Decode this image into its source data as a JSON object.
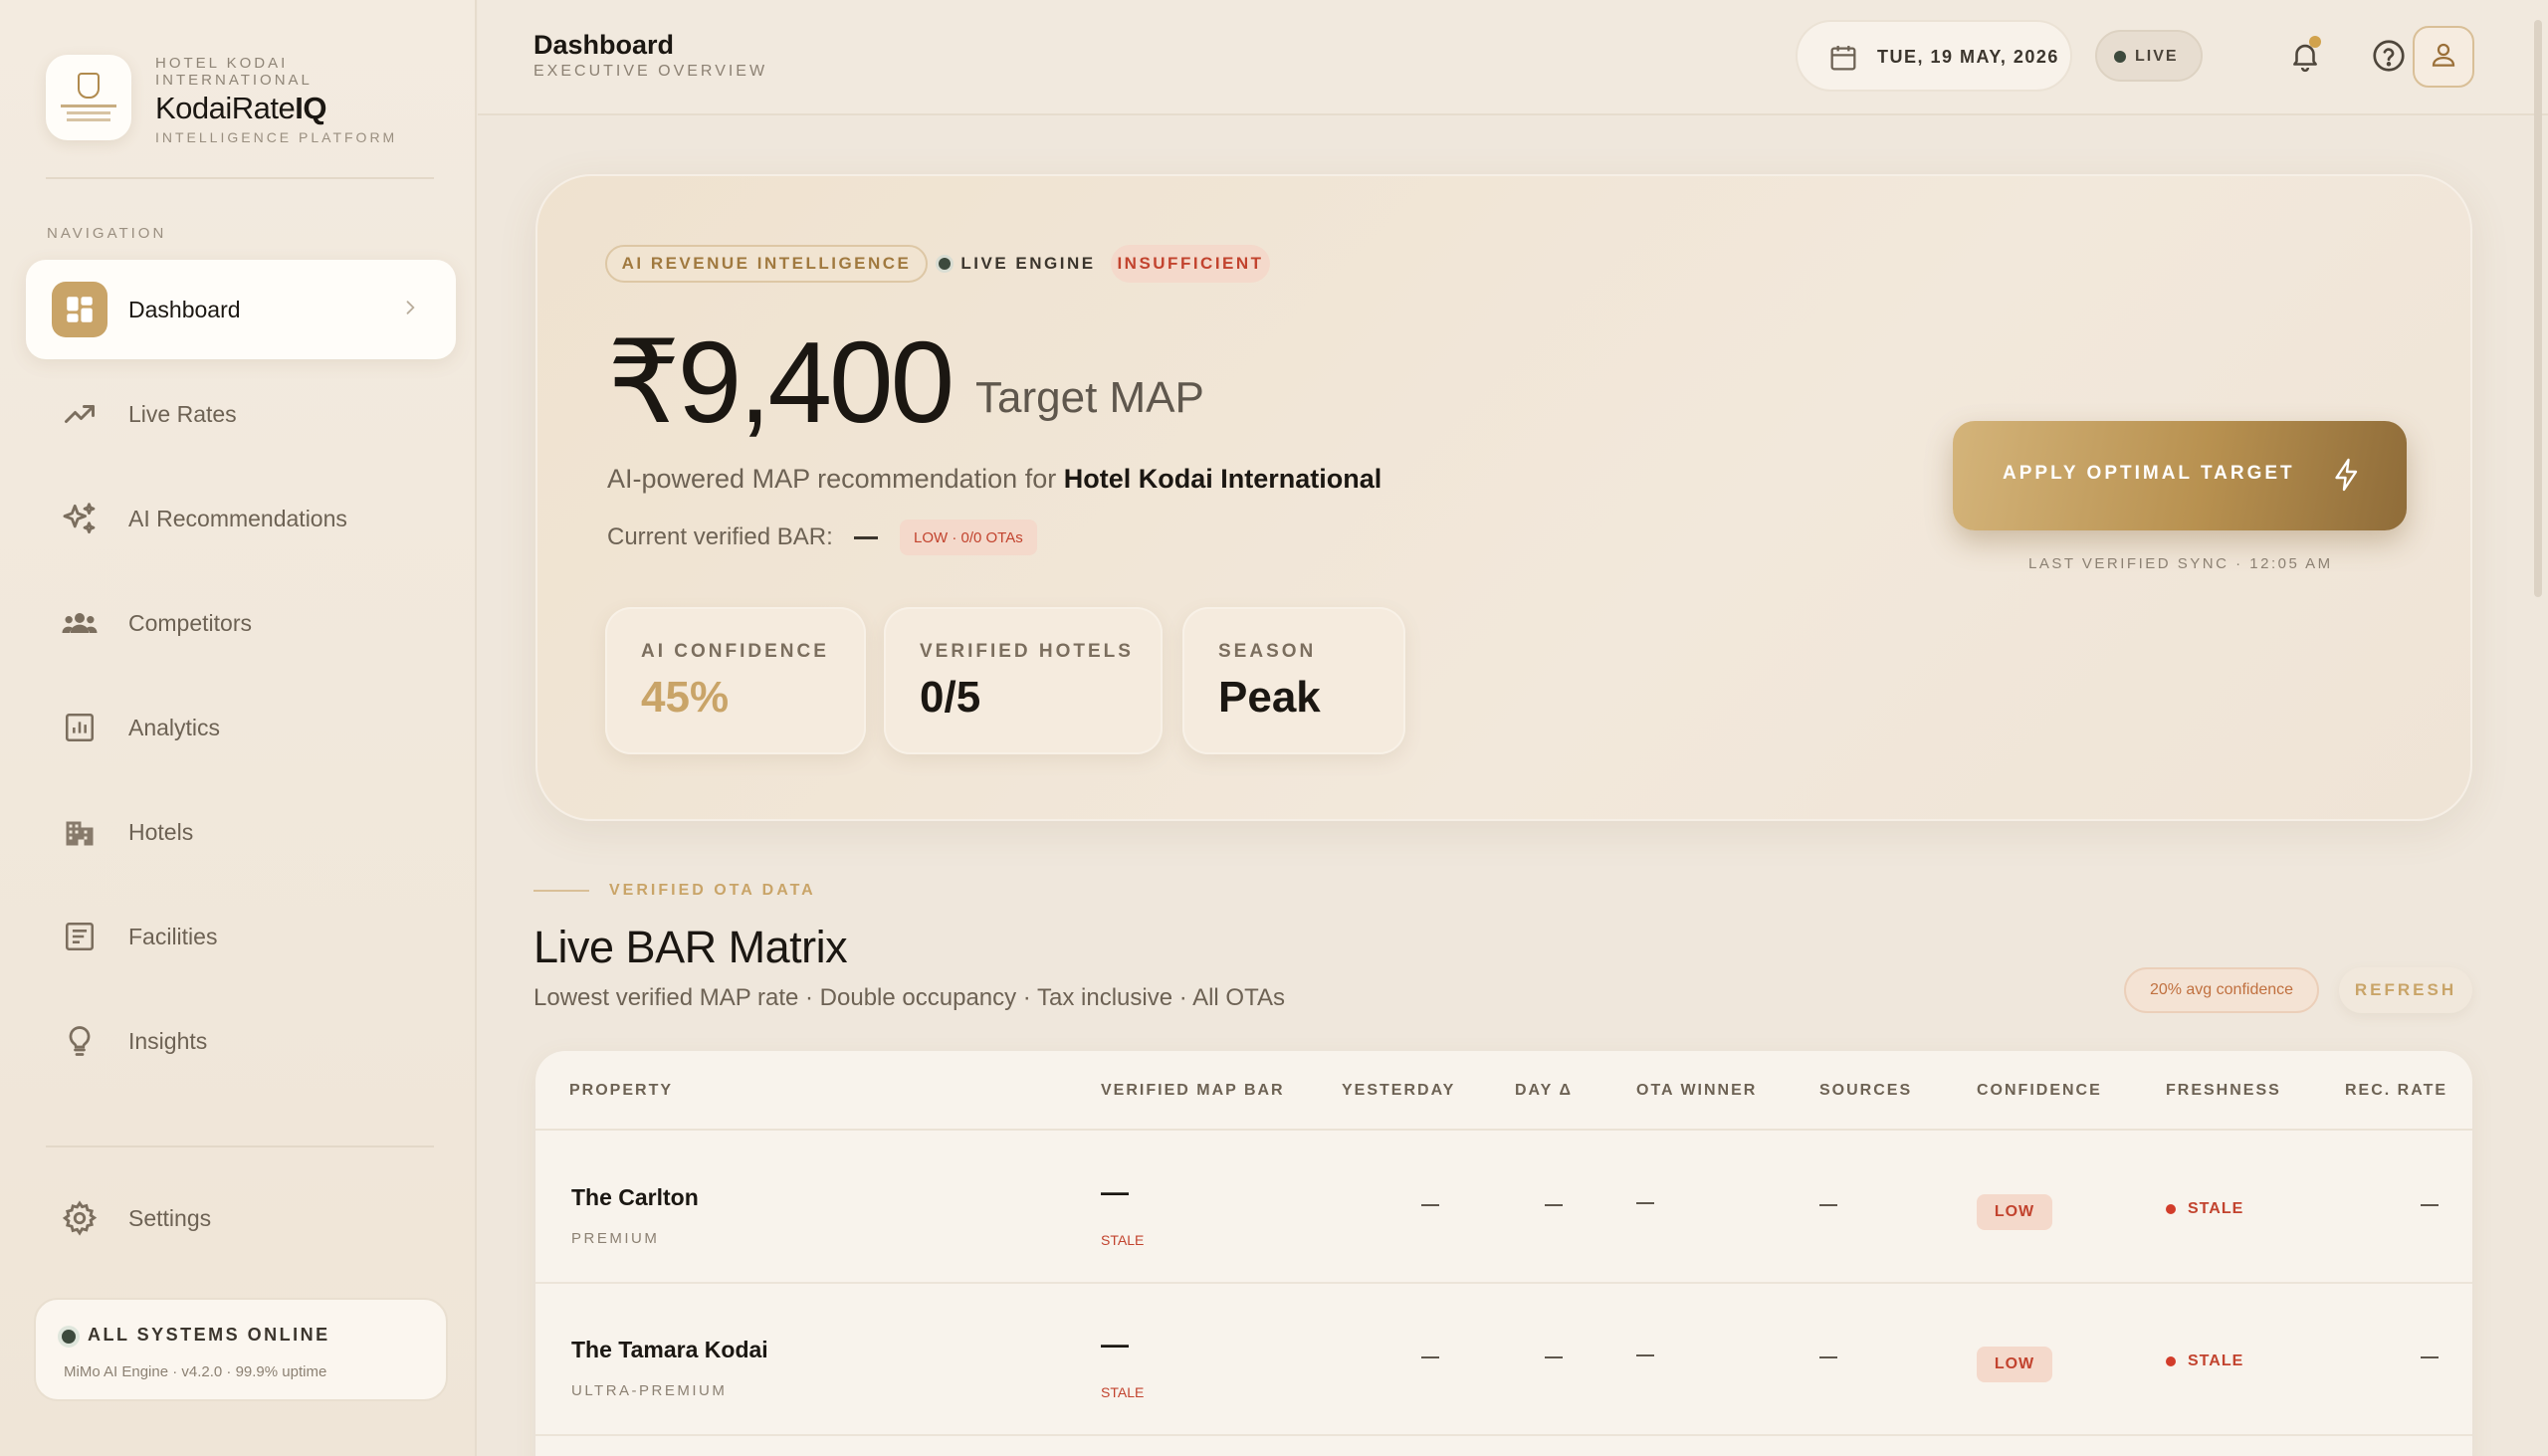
{
  "brand": {
    "overline": "HOTEL KODAI INTERNATIONAL",
    "name_regular": "KodaiRate",
    "name_bold": "IQ",
    "subtitle": "INTELLIGENCE PLATFORM"
  },
  "sidebar": {
    "nav_heading": "NAVIGATION",
    "items": [
      {
        "label": "Dashboard",
        "icon": "dashboard-grid-icon",
        "active": true
      },
      {
        "label": "Live Rates",
        "icon": "trending-up-icon"
      },
      {
        "label": "AI Recommendations",
        "icon": "sparkles-icon"
      },
      {
        "label": "Competitors",
        "icon": "users-icon"
      },
      {
        "label": "Analytics",
        "icon": "bar-chart-icon"
      },
      {
        "label": "Hotels",
        "icon": "building-icon"
      },
      {
        "label": "Facilities",
        "icon": "clipboard-icon"
      },
      {
        "label": "Insights",
        "icon": "lightbulb-icon"
      }
    ],
    "settings_label": "Settings",
    "status": {
      "title": "ALL SYSTEMS ONLINE",
      "detail": "MiMo AI Engine · v4.2.0 · 99.9% uptime"
    }
  },
  "topbar": {
    "title": "Dashboard",
    "subtitle": "EXECUTIVE OVERVIEW",
    "date": "TUE, 19 MAY, 2026",
    "live_label": "LIVE"
  },
  "hero": {
    "chip_ai": "AI REVENUE INTELLIGENCE",
    "chip_live": "LIVE ENGINE",
    "chip_status": "INSUFFICIENT",
    "price": "₹9,400",
    "price_label": "Target MAP",
    "rec_prefix": "AI-powered MAP recommendation for",
    "rec_hotel": "Hotel Kodai International",
    "bar_label": "Current verified BAR:",
    "bar_badge": "LOW · 0/0 OTAs",
    "metrics": [
      {
        "label": "AI CONFIDENCE",
        "value": "45%"
      },
      {
        "label": "VERIFIED HOTELS",
        "value": "0/5"
      },
      {
        "label": "SEASON",
        "value": "Peak"
      }
    ],
    "apply_label": "APPLY OPTIMAL TARGET",
    "sync_text": "LAST VERIFIED SYNC · 12:05 AM"
  },
  "matrix": {
    "eyebrow": "VERIFIED OTA DATA",
    "title": "Live BAR Matrix",
    "subtitle": "Lowest verified MAP rate · Double occupancy · Tax inclusive · All OTAs",
    "confidence_pill": "20% avg confidence",
    "refresh_label": "REFRESH",
    "columns": [
      "PROPERTY",
      "VERIFIED MAP BAR",
      "YESTERDAY",
      "DAY Δ",
      "OTA WINNER",
      "SOURCES",
      "CONFIDENCE",
      "FRESHNESS",
      "REC. RATE"
    ],
    "rows": [
      {
        "name": "The Carlton",
        "tier": "PREMIUM",
        "bar": "—",
        "bar_status": "STALE",
        "confidence": "LOW",
        "freshness": "STALE"
      },
      {
        "name": "The Tamara Kodai",
        "tier": "ULTRA-PREMIUM",
        "bar": "—",
        "bar_status": "STALE",
        "confidence": "LOW",
        "freshness": "STALE"
      }
    ]
  },
  "colors": {
    "accent_gold": "#c9a468",
    "status_red": "#c2432e",
    "online_green": "#3d4a3d"
  }
}
